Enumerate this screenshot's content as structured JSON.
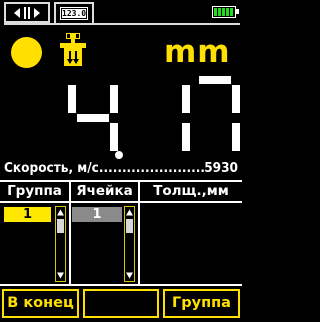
{
  "status_bar": {
    "tab_left_icon": "sensor-gap-icon",
    "tab_right_icon": "numeric-display-icon",
    "tab_right_text": "123.0",
    "battery_level": 1.0,
    "battery_color": "#22dd22"
  },
  "indicators": {
    "status_dot_color": "#ffe000",
    "probe_icon": "probe-icon",
    "unit": "mm"
  },
  "measurement": {
    "digits": [
      "4",
      "1",
      "7"
    ],
    "decimal_after_index": 0,
    "value": "4.17"
  },
  "speed": {
    "label": "Скорость, м/с",
    "dots": ".............................",
    "value": "5930"
  },
  "table": {
    "headers": [
      "Группа",
      "Ячейка",
      "Толщ.,мм"
    ],
    "group_value": "1",
    "cell_value": "1"
  },
  "buttons": {
    "left": "В конец",
    "middle": "",
    "right": "Группа"
  },
  "colors": {
    "accent": "#ffe000",
    "background": "#000000",
    "foreground": "#ffffff",
    "cell_selected": "#8a8a8a"
  }
}
